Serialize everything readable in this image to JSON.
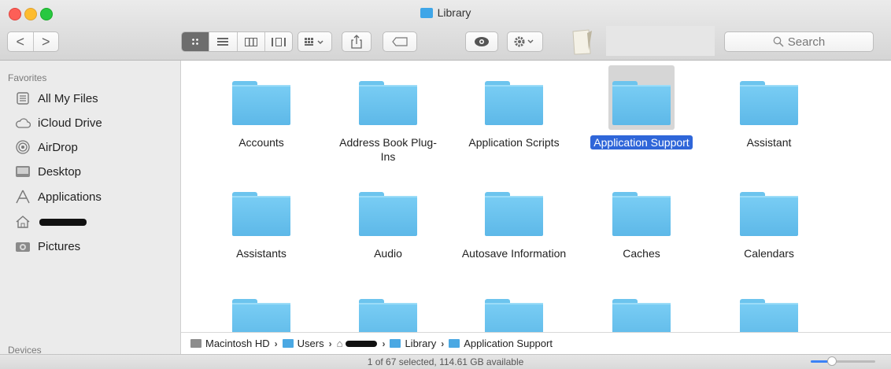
{
  "window": {
    "title": "Library"
  },
  "toolbar": {
    "back": "<",
    "forward": ">",
    "search_placeholder": "Search"
  },
  "sidebar": {
    "favorites_header": "Favorites",
    "items": [
      {
        "label": "All My Files",
        "icon": "all-files-icon"
      },
      {
        "label": "iCloud Drive",
        "icon": "cloud-icon"
      },
      {
        "label": "AirDrop",
        "icon": "airdrop-icon"
      },
      {
        "label": "Desktop",
        "icon": "desktop-icon"
      },
      {
        "label": "Applications",
        "icon": "applications-icon"
      },
      {
        "label": "",
        "icon": "home-icon"
      },
      {
        "label": "Pictures",
        "icon": "camera-icon"
      }
    ],
    "devices_header": "Devices"
  },
  "folders": [
    {
      "label": "Accounts",
      "selected": false
    },
    {
      "label": "Address Book Plug-Ins",
      "selected": false
    },
    {
      "label": "Application Scripts",
      "selected": false
    },
    {
      "label": "Application Support",
      "selected": true
    },
    {
      "label": "Assistant",
      "selected": false
    },
    {
      "label": "Assistants",
      "selected": false
    },
    {
      "label": "Audio",
      "selected": false
    },
    {
      "label": "Autosave Information",
      "selected": false
    },
    {
      "label": "Caches",
      "selected": false
    },
    {
      "label": "Calendars",
      "selected": false
    },
    {
      "label": "",
      "selected": false
    },
    {
      "label": "",
      "selected": false
    },
    {
      "label": "",
      "selected": false
    },
    {
      "label": "",
      "selected": false
    },
    {
      "label": "",
      "selected": false
    }
  ],
  "pathbar": {
    "segments": [
      "Macintosh HD",
      "Users",
      "",
      "Library",
      "Application Support"
    ]
  },
  "status": {
    "text": "1 of 67 selected, 114.61 GB available",
    "icon_size_level": 0.33
  },
  "colors": {
    "selection": "#2f66d9",
    "folder": "#6cc4ee"
  }
}
